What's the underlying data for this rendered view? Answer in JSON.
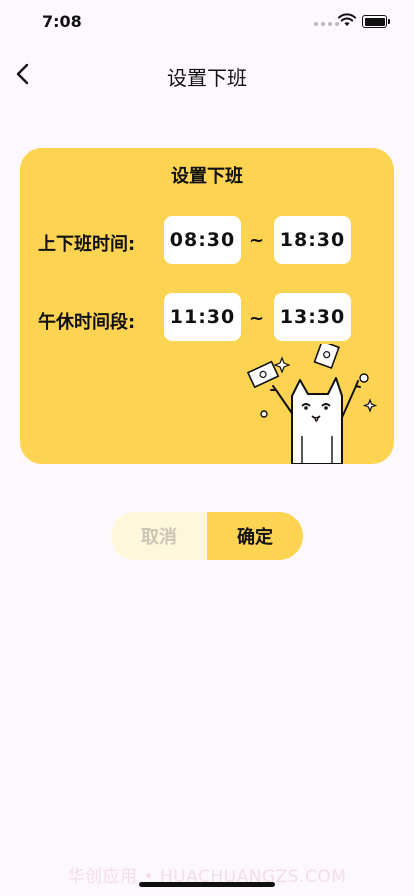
{
  "status": {
    "time": "7:08"
  },
  "nav": {
    "title": "设置下班"
  },
  "card": {
    "title": "设置下班",
    "work_label": "上下班时间:",
    "work_start": "08:30",
    "work_end": "18:30",
    "lunch_label": "午休时间段:",
    "lunch_start": "11:30",
    "lunch_end": "13:30",
    "separator": "~"
  },
  "buttons": {
    "cancel": "取消",
    "confirm": "确定"
  },
  "watermark": "华创应用 • HUACHUANGZS.COM",
  "colors": {
    "accent": "#fdd452",
    "cancel_bg": "#fff7dc",
    "cancel_text": "#c9c4b4",
    "background": "#fdf8fd"
  }
}
